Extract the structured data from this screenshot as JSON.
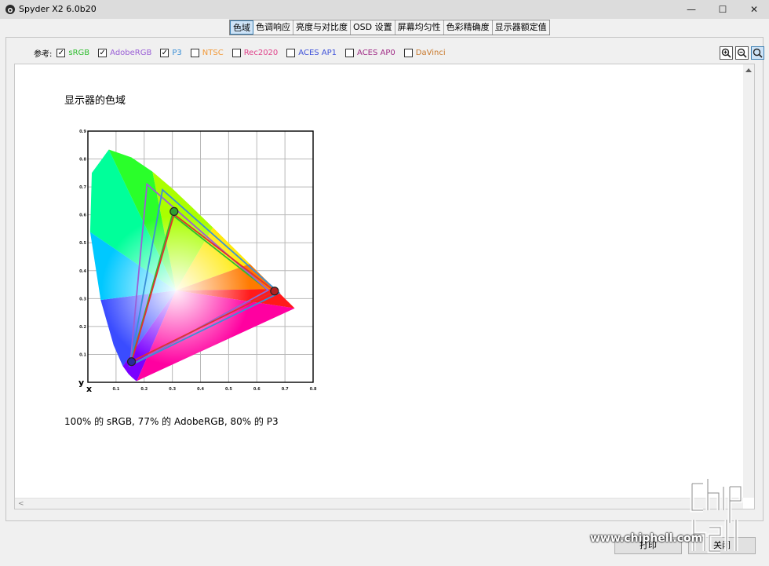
{
  "window": {
    "title": "Spyder X2 6.0b20",
    "minimize": "—",
    "maximize": "☐",
    "close": "✕"
  },
  "tabs": [
    {
      "label": "色域",
      "active": true
    },
    {
      "label": "色调响应",
      "active": false
    },
    {
      "label": "亮度与对比度",
      "active": false
    },
    {
      "label": "OSD 设置",
      "active": false
    },
    {
      "label": "屏幕均匀性",
      "active": false
    },
    {
      "label": "色彩精确度",
      "active": false
    },
    {
      "label": "显示器额定值",
      "active": false
    }
  ],
  "references": {
    "label": "参考:",
    "items": [
      {
        "label": "sRGB",
        "checked": true,
        "color": "#2ebd2e"
      },
      {
        "label": "AdobeRGB",
        "checked": true,
        "color": "#9a5fd6"
      },
      {
        "label": "P3",
        "checked": true,
        "color": "#3a8fd6"
      },
      {
        "label": "NTSC",
        "checked": false,
        "color": "#f29a3a"
      },
      {
        "label": "Rec2020",
        "checked": false,
        "color": "#e0428a"
      },
      {
        "label": "ACES AP1",
        "checked": false,
        "color": "#3f52d9"
      },
      {
        "label": "ACES AP0",
        "checked": false,
        "color": "#a02c86"
      },
      {
        "label": "DaVinci",
        "checked": false,
        "color": "#c8782a"
      }
    ]
  },
  "zoom_tools": [
    {
      "icon": "zoom-in-icon",
      "selected": false
    },
    {
      "icon": "zoom-out-icon",
      "selected": false
    },
    {
      "icon": "zoom-fit-icon",
      "selected": true
    }
  ],
  "content": {
    "heading": "显示器的色域",
    "summary": "100% 的 sRGB, 77% 的 AdobeRGB, 80% 的 P3"
  },
  "buttons": {
    "print": "打印",
    "close": "关闭"
  },
  "watermark": {
    "site": "www.chiphell.com"
  },
  "chart_data": {
    "type": "scatter",
    "title": "",
    "xlabel": "x",
    "ylabel": "y",
    "xlim": [
      0,
      0.8
    ],
    "ylim": [
      0,
      0.9
    ],
    "x_ticks": [
      "0.1",
      "0.2",
      "0.3",
      "0.4",
      "0.5",
      "0.6",
      "0.7",
      "0.8"
    ],
    "y_ticks": [
      "0.1",
      "0.2",
      "0.3",
      "0.4",
      "0.5",
      "0.6",
      "0.7",
      "0.8",
      "0.9"
    ],
    "grid": true,
    "series": [
      {
        "name": "sRGB",
        "color": "#2ebd2e",
        "points": [
          [
            0.64,
            0.33
          ],
          [
            0.3,
            0.6
          ],
          [
            0.15,
            0.06
          ]
        ]
      },
      {
        "name": "AdobeRGB",
        "color": "#9a5fd6",
        "points": [
          [
            0.64,
            0.33
          ],
          [
            0.21,
            0.71
          ],
          [
            0.15,
            0.06
          ]
        ]
      },
      {
        "name": "P3",
        "color": "#3a8fd6",
        "points": [
          [
            0.68,
            0.32
          ],
          [
            0.265,
            0.69
          ],
          [
            0.15,
            0.06
          ]
        ]
      },
      {
        "name": "",
        "color": "#e03030",
        "points": [
          [
            0.663,
            0.327
          ],
          [
            0.306,
            0.602
          ],
          [
            0.155,
            0.074
          ]
        ]
      }
    ],
    "markers": [
      {
        "x": 0.306,
        "y": 0.612,
        "color": "#30a030"
      },
      {
        "x": 0.663,
        "y": 0.327,
        "color": "#b02020"
      },
      {
        "x": 0.155,
        "y": 0.074,
        "color": "#2a2a9a"
      }
    ]
  }
}
